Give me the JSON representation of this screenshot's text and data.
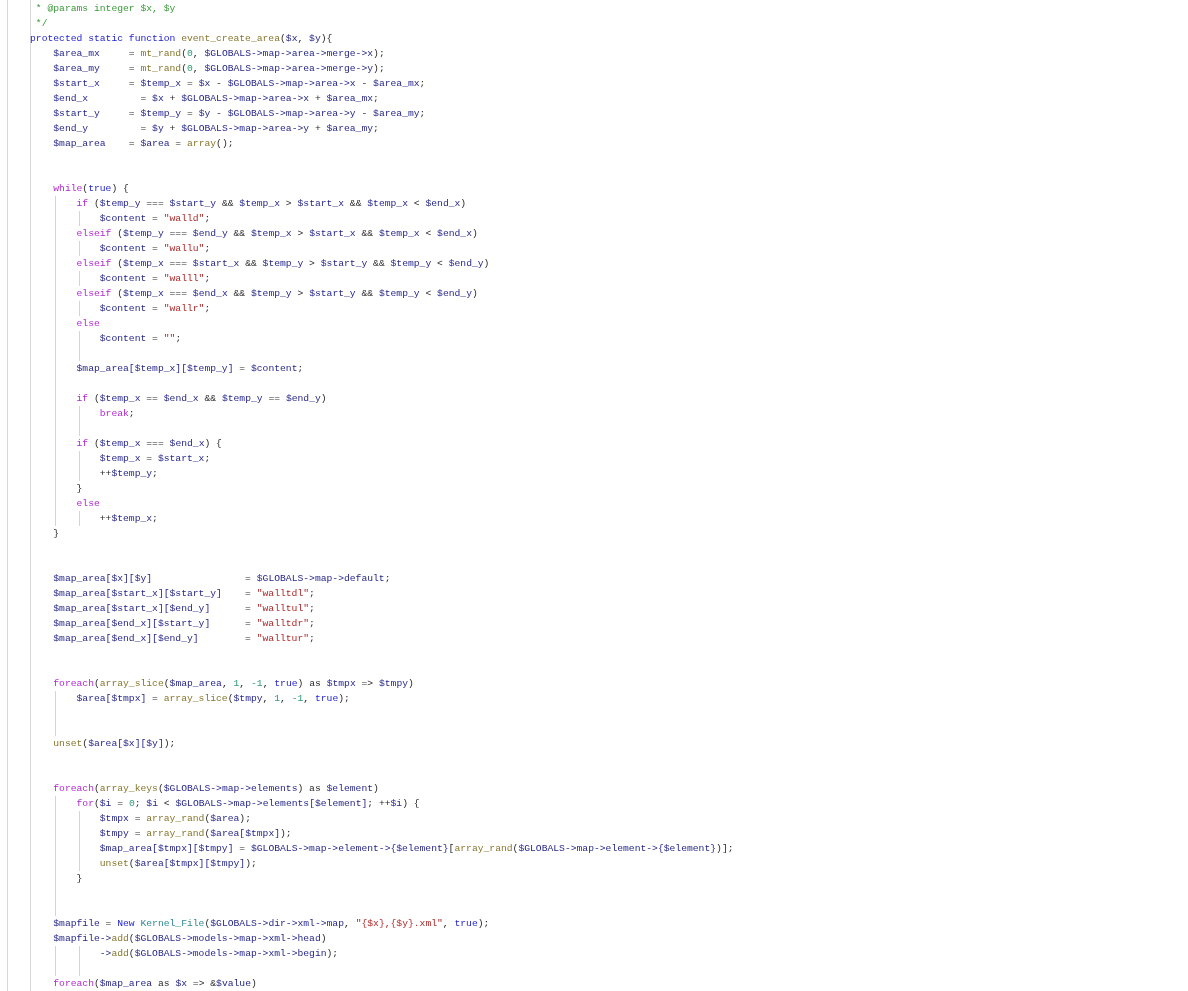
{
  "editor": {
    "lines": [
      {
        "kind": "code",
        "tokens": [
          {
            "kind": "comment",
            "text": " * @params integer $x, $y"
          }
        ]
      },
      {
        "kind": "code",
        "tokens": [
          {
            "kind": "comment",
            "text": " */"
          }
        ]
      },
      {
        "kind": "code",
        "tokens": [
          {
            "kind": "decl",
            "text": "protected static function "
          },
          {
            "kind": "fn",
            "text": "event_create_area"
          },
          {
            "kind": "plain",
            "text": "("
          },
          {
            "kind": "var",
            "text": "$x"
          },
          {
            "kind": "plain",
            "text": ", "
          },
          {
            "kind": "var",
            "text": "$y"
          },
          {
            "kind": "plain",
            "text": "){"
          }
        ]
      },
      {
        "kind": "code",
        "tokens": [
          {
            "kind": "var",
            "text": "    $area_mx"
          },
          {
            "kind": "plain",
            "text": "     = "
          },
          {
            "kind": "fn",
            "text": "mt_rand"
          },
          {
            "kind": "plain",
            "text": "("
          },
          {
            "kind": "num",
            "text": "0"
          },
          {
            "kind": "plain",
            "text": ", "
          },
          {
            "kind": "var",
            "text": "$GLOBALS->map->area->merge->x"
          },
          {
            "kind": "plain",
            "text": ");"
          }
        ]
      },
      {
        "kind": "code",
        "tokens": [
          {
            "kind": "var",
            "text": "    $area_my"
          },
          {
            "kind": "plain",
            "text": "     = "
          },
          {
            "kind": "fn",
            "text": "mt_rand"
          },
          {
            "kind": "plain",
            "text": "("
          },
          {
            "kind": "num",
            "text": "0"
          },
          {
            "kind": "plain",
            "text": ", "
          },
          {
            "kind": "var",
            "text": "$GLOBALS->map->area->merge->y"
          },
          {
            "kind": "plain",
            "text": ");"
          }
        ]
      },
      {
        "kind": "code",
        "tokens": [
          {
            "kind": "var",
            "text": "    $start_x"
          },
          {
            "kind": "plain",
            "text": "     = "
          },
          {
            "kind": "var",
            "text": "$temp_x"
          },
          {
            "kind": "plain",
            "text": " = "
          },
          {
            "kind": "var",
            "text": "$x"
          },
          {
            "kind": "plain",
            "text": " - "
          },
          {
            "kind": "var",
            "text": "$GLOBALS->map->area->x"
          },
          {
            "kind": "plain",
            "text": " - "
          },
          {
            "kind": "var",
            "text": "$area_mx"
          },
          {
            "kind": "plain",
            "text": ";"
          }
        ]
      },
      {
        "kind": "code",
        "tokens": [
          {
            "kind": "var",
            "text": "    $end_x"
          },
          {
            "kind": "plain",
            "text": "         = "
          },
          {
            "kind": "var",
            "text": "$x"
          },
          {
            "kind": "plain",
            "text": " + "
          },
          {
            "kind": "var",
            "text": "$GLOBALS->map->area->x"
          },
          {
            "kind": "plain",
            "text": " + "
          },
          {
            "kind": "var",
            "text": "$area_mx"
          },
          {
            "kind": "plain",
            "text": ";"
          }
        ]
      },
      {
        "kind": "code",
        "tokens": [
          {
            "kind": "var",
            "text": "    $start_y"
          },
          {
            "kind": "plain",
            "text": "     = "
          },
          {
            "kind": "var",
            "text": "$temp_y"
          },
          {
            "kind": "plain",
            "text": " = "
          },
          {
            "kind": "var",
            "text": "$y"
          },
          {
            "kind": "plain",
            "text": " - "
          },
          {
            "kind": "var",
            "text": "$GLOBALS->map->area->y"
          },
          {
            "kind": "plain",
            "text": " - "
          },
          {
            "kind": "var",
            "text": "$area_my"
          },
          {
            "kind": "plain",
            "text": ";"
          }
        ]
      },
      {
        "kind": "code",
        "tokens": [
          {
            "kind": "var",
            "text": "    $end_y"
          },
          {
            "kind": "plain",
            "text": "         = "
          },
          {
            "kind": "var",
            "text": "$y"
          },
          {
            "kind": "plain",
            "text": " + "
          },
          {
            "kind": "var",
            "text": "$GLOBALS->map->area->y"
          },
          {
            "kind": "plain",
            "text": " + "
          },
          {
            "kind": "var",
            "text": "$area_my"
          },
          {
            "kind": "plain",
            "text": ";"
          }
        ]
      },
      {
        "kind": "code",
        "tokens": [
          {
            "kind": "var",
            "text": "    $map_area"
          },
          {
            "kind": "plain",
            "text": "    = "
          },
          {
            "kind": "var",
            "text": "$area"
          },
          {
            "kind": "plain",
            "text": " = "
          },
          {
            "kind": "fn",
            "text": "array"
          },
          {
            "kind": "plain",
            "text": "();"
          }
        ]
      },
      {
        "kind": "blank"
      },
      {
        "kind": "blank"
      },
      {
        "kind": "code",
        "tokens": [
          {
            "kind": "kw",
            "text": "    while"
          },
          {
            "kind": "plain",
            "text": "("
          },
          {
            "kind": "decl",
            "text": "true"
          },
          {
            "kind": "plain",
            "text": ") {"
          }
        ]
      },
      {
        "kind": "code",
        "tokens": [
          {
            "kind": "kw",
            "text": "        if"
          },
          {
            "kind": "plain",
            "text": " ("
          },
          {
            "kind": "var",
            "text": "$temp_y"
          },
          {
            "kind": "plain",
            "text": " === "
          },
          {
            "kind": "var",
            "text": "$start_y"
          },
          {
            "kind": "plain",
            "text": " && "
          },
          {
            "kind": "var",
            "text": "$temp_x"
          },
          {
            "kind": "plain",
            "text": " > "
          },
          {
            "kind": "var",
            "text": "$start_x"
          },
          {
            "kind": "plain",
            "text": " && "
          },
          {
            "kind": "var",
            "text": "$temp_x"
          },
          {
            "kind": "plain",
            "text": " < "
          },
          {
            "kind": "var",
            "text": "$end_x"
          },
          {
            "kind": "plain",
            "text": ")"
          }
        ]
      },
      {
        "kind": "code",
        "tokens": [
          {
            "kind": "var",
            "text": "            $content"
          },
          {
            "kind": "plain",
            "text": " = "
          },
          {
            "kind": "str",
            "text": "\"walld\""
          },
          {
            "kind": "plain",
            "text": ";"
          }
        ]
      },
      {
        "kind": "code",
        "tokens": [
          {
            "kind": "kw",
            "text": "        elseif"
          },
          {
            "kind": "plain",
            "text": " ("
          },
          {
            "kind": "var",
            "text": "$temp_y"
          },
          {
            "kind": "plain",
            "text": " === "
          },
          {
            "kind": "var",
            "text": "$end_y"
          },
          {
            "kind": "plain",
            "text": " && "
          },
          {
            "kind": "var",
            "text": "$temp_x"
          },
          {
            "kind": "plain",
            "text": " > "
          },
          {
            "kind": "var",
            "text": "$start_x"
          },
          {
            "kind": "plain",
            "text": " && "
          },
          {
            "kind": "var",
            "text": "$temp_x"
          },
          {
            "kind": "plain",
            "text": " < "
          },
          {
            "kind": "var",
            "text": "$end_x"
          },
          {
            "kind": "plain",
            "text": ")"
          }
        ]
      },
      {
        "kind": "code",
        "tokens": [
          {
            "kind": "var",
            "text": "            $content"
          },
          {
            "kind": "plain",
            "text": " = "
          },
          {
            "kind": "str",
            "text": "\"wallu\""
          },
          {
            "kind": "plain",
            "text": ";"
          }
        ]
      },
      {
        "kind": "code",
        "tokens": [
          {
            "kind": "kw",
            "text": "        elseif"
          },
          {
            "kind": "plain",
            "text": " ("
          },
          {
            "kind": "var",
            "text": "$temp_x"
          },
          {
            "kind": "plain",
            "text": " === "
          },
          {
            "kind": "var",
            "text": "$start_x"
          },
          {
            "kind": "plain",
            "text": " && "
          },
          {
            "kind": "var",
            "text": "$temp_y"
          },
          {
            "kind": "plain",
            "text": " > "
          },
          {
            "kind": "var",
            "text": "$start_y"
          },
          {
            "kind": "plain",
            "text": " && "
          },
          {
            "kind": "var",
            "text": "$temp_y"
          },
          {
            "kind": "plain",
            "text": " < "
          },
          {
            "kind": "var",
            "text": "$end_y"
          },
          {
            "kind": "plain",
            "text": ")"
          }
        ]
      },
      {
        "kind": "code",
        "tokens": [
          {
            "kind": "var",
            "text": "            $content"
          },
          {
            "kind": "plain",
            "text": " = "
          },
          {
            "kind": "str",
            "text": "\"walll\""
          },
          {
            "kind": "plain",
            "text": ";"
          }
        ]
      },
      {
        "kind": "code",
        "tokens": [
          {
            "kind": "kw",
            "text": "        elseif"
          },
          {
            "kind": "plain",
            "text": " ("
          },
          {
            "kind": "var",
            "text": "$temp_x"
          },
          {
            "kind": "plain",
            "text": " === "
          },
          {
            "kind": "var",
            "text": "$end_x"
          },
          {
            "kind": "plain",
            "text": " && "
          },
          {
            "kind": "var",
            "text": "$temp_y"
          },
          {
            "kind": "plain",
            "text": " > "
          },
          {
            "kind": "var",
            "text": "$start_y"
          },
          {
            "kind": "plain",
            "text": " && "
          },
          {
            "kind": "var",
            "text": "$temp_y"
          },
          {
            "kind": "plain",
            "text": " < "
          },
          {
            "kind": "var",
            "text": "$end_y"
          },
          {
            "kind": "plain",
            "text": ")"
          }
        ]
      },
      {
        "kind": "code",
        "tokens": [
          {
            "kind": "var",
            "text": "            $content"
          },
          {
            "kind": "plain",
            "text": " = "
          },
          {
            "kind": "str",
            "text": "\"wallr\""
          },
          {
            "kind": "plain",
            "text": ";"
          }
        ]
      },
      {
        "kind": "code",
        "tokens": [
          {
            "kind": "kw",
            "text": "        else"
          }
        ]
      },
      {
        "kind": "code",
        "tokens": [
          {
            "kind": "var",
            "text": "            $content"
          },
          {
            "kind": "plain",
            "text": " = "
          },
          {
            "kind": "str",
            "text": "\"\""
          },
          {
            "kind": "plain",
            "text": ";"
          }
        ]
      },
      {
        "kind": "blank"
      },
      {
        "kind": "code",
        "tokens": [
          {
            "kind": "var",
            "text": "        $map_area[$temp_x][$temp_y]"
          },
          {
            "kind": "plain",
            "text": " = "
          },
          {
            "kind": "var",
            "text": "$content"
          },
          {
            "kind": "plain",
            "text": ";"
          }
        ]
      },
      {
        "kind": "blank"
      },
      {
        "kind": "code",
        "tokens": [
          {
            "kind": "kw",
            "text": "        if"
          },
          {
            "kind": "plain",
            "text": " ("
          },
          {
            "kind": "var",
            "text": "$temp_x"
          },
          {
            "kind": "plain",
            "text": " == "
          },
          {
            "kind": "var",
            "text": "$end_x"
          },
          {
            "kind": "plain",
            "text": " && "
          },
          {
            "kind": "var",
            "text": "$temp_y"
          },
          {
            "kind": "plain",
            "text": " == "
          },
          {
            "kind": "var",
            "text": "$end_y"
          },
          {
            "kind": "plain",
            "text": ")"
          }
        ]
      },
      {
        "kind": "code",
        "tokens": [
          {
            "kind": "kw",
            "text": "            break"
          },
          {
            "kind": "plain",
            "text": ";"
          }
        ]
      },
      {
        "kind": "blank"
      },
      {
        "kind": "code",
        "tokens": [
          {
            "kind": "kw",
            "text": "        if"
          },
          {
            "kind": "plain",
            "text": " ("
          },
          {
            "kind": "var",
            "text": "$temp_x"
          },
          {
            "kind": "plain",
            "text": " === "
          },
          {
            "kind": "var",
            "text": "$end_x"
          },
          {
            "kind": "plain",
            "text": ") {"
          }
        ]
      },
      {
        "kind": "code",
        "tokens": [
          {
            "kind": "var",
            "text": "            $temp_x"
          },
          {
            "kind": "plain",
            "text": " = "
          },
          {
            "kind": "var",
            "text": "$start_x"
          },
          {
            "kind": "plain",
            "text": ";"
          }
        ]
      },
      {
        "kind": "code",
        "tokens": [
          {
            "kind": "plain",
            "text": "            ++"
          },
          {
            "kind": "var",
            "text": "$temp_y"
          },
          {
            "kind": "plain",
            "text": ";"
          }
        ]
      },
      {
        "kind": "code",
        "tokens": [
          {
            "kind": "plain",
            "text": "        }"
          }
        ]
      },
      {
        "kind": "code",
        "tokens": [
          {
            "kind": "kw",
            "text": "        else"
          }
        ]
      },
      {
        "kind": "code",
        "tokens": [
          {
            "kind": "plain",
            "text": "            ++"
          },
          {
            "kind": "var",
            "text": "$temp_x"
          },
          {
            "kind": "plain",
            "text": ";"
          }
        ]
      },
      {
        "kind": "code",
        "tokens": [
          {
            "kind": "plain",
            "text": "    }"
          }
        ]
      },
      {
        "kind": "blank"
      },
      {
        "kind": "blank"
      },
      {
        "kind": "code",
        "tokens": [
          {
            "kind": "var",
            "text": "    $map_area[$x][$y]"
          },
          {
            "kind": "plain",
            "text": "                = "
          },
          {
            "kind": "var",
            "text": "$GLOBALS->map->default"
          },
          {
            "kind": "plain",
            "text": ";"
          }
        ]
      },
      {
        "kind": "code",
        "tokens": [
          {
            "kind": "var",
            "text": "    $map_area[$start_x][$start_y]"
          },
          {
            "kind": "plain",
            "text": "    = "
          },
          {
            "kind": "str",
            "text": "\"walltdl\""
          },
          {
            "kind": "plain",
            "text": ";"
          }
        ]
      },
      {
        "kind": "code",
        "tokens": [
          {
            "kind": "var",
            "text": "    $map_area[$start_x][$end_y]"
          },
          {
            "kind": "plain",
            "text": "      = "
          },
          {
            "kind": "str",
            "text": "\"walltul\""
          },
          {
            "kind": "plain",
            "text": ";"
          }
        ]
      },
      {
        "kind": "code",
        "tokens": [
          {
            "kind": "var",
            "text": "    $map_area[$end_x][$start_y]"
          },
          {
            "kind": "plain",
            "text": "      = "
          },
          {
            "kind": "str",
            "text": "\"walltdr\""
          },
          {
            "kind": "plain",
            "text": ";"
          }
        ]
      },
      {
        "kind": "code",
        "tokens": [
          {
            "kind": "var",
            "text": "    $map_area[$end_x][$end_y]"
          },
          {
            "kind": "plain",
            "text": "        = "
          },
          {
            "kind": "str",
            "text": "\"walltur\""
          },
          {
            "kind": "plain",
            "text": ";"
          }
        ]
      },
      {
        "kind": "blank"
      },
      {
        "kind": "blank"
      },
      {
        "kind": "code",
        "tokens": [
          {
            "kind": "kw",
            "text": "    foreach"
          },
          {
            "kind": "plain",
            "text": "("
          },
          {
            "kind": "fn",
            "text": "array_slice"
          },
          {
            "kind": "plain",
            "text": "("
          },
          {
            "kind": "var",
            "text": "$map_area"
          },
          {
            "kind": "plain",
            "text": ", "
          },
          {
            "kind": "num",
            "text": "1"
          },
          {
            "kind": "plain",
            "text": ", "
          },
          {
            "kind": "num",
            "text": "-1"
          },
          {
            "kind": "plain",
            "text": ", "
          },
          {
            "kind": "decl",
            "text": "true"
          },
          {
            "kind": "plain",
            "text": ") as "
          },
          {
            "kind": "var",
            "text": "$tmpx"
          },
          {
            "kind": "plain",
            "text": " => "
          },
          {
            "kind": "var",
            "text": "$tmpy"
          },
          {
            "kind": "plain",
            "text": ")"
          }
        ]
      },
      {
        "kind": "code",
        "tokens": [
          {
            "kind": "var",
            "text": "        $area[$tmpx]"
          },
          {
            "kind": "plain",
            "text": " = "
          },
          {
            "kind": "fn",
            "text": "array_slice"
          },
          {
            "kind": "plain",
            "text": "("
          },
          {
            "kind": "var",
            "text": "$tmpy"
          },
          {
            "kind": "plain",
            "text": ", "
          },
          {
            "kind": "num",
            "text": "1"
          },
          {
            "kind": "plain",
            "text": ", "
          },
          {
            "kind": "num",
            "text": "-1"
          },
          {
            "kind": "plain",
            "text": ", "
          },
          {
            "kind": "decl",
            "text": "true"
          },
          {
            "kind": "plain",
            "text": ");"
          }
        ]
      },
      {
        "kind": "blank"
      },
      {
        "kind": "blank"
      },
      {
        "kind": "code",
        "tokens": [
          {
            "kind": "fn",
            "text": "    unset"
          },
          {
            "kind": "plain",
            "text": "("
          },
          {
            "kind": "var",
            "text": "$area[$x][$y]"
          },
          {
            "kind": "plain",
            "text": ");"
          }
        ]
      },
      {
        "kind": "blank"
      },
      {
        "kind": "blank"
      },
      {
        "kind": "code",
        "tokens": [
          {
            "kind": "kw",
            "text": "    foreach"
          },
          {
            "kind": "plain",
            "text": "("
          },
          {
            "kind": "fn",
            "text": "array_keys"
          },
          {
            "kind": "plain",
            "text": "("
          },
          {
            "kind": "var",
            "text": "$GLOBALS->map->elements"
          },
          {
            "kind": "plain",
            "text": ") as "
          },
          {
            "kind": "var",
            "text": "$element"
          },
          {
            "kind": "plain",
            "text": ")"
          }
        ]
      },
      {
        "kind": "code",
        "tokens": [
          {
            "kind": "kw",
            "text": "        for"
          },
          {
            "kind": "plain",
            "text": "("
          },
          {
            "kind": "var",
            "text": "$i"
          },
          {
            "kind": "plain",
            "text": " = "
          },
          {
            "kind": "num",
            "text": "0"
          },
          {
            "kind": "plain",
            "text": "; "
          },
          {
            "kind": "var",
            "text": "$i"
          },
          {
            "kind": "plain",
            "text": " < "
          },
          {
            "kind": "var",
            "text": "$GLOBALS->map->elements[$element]"
          },
          {
            "kind": "plain",
            "text": "; ++"
          },
          {
            "kind": "var",
            "text": "$i"
          },
          {
            "kind": "plain",
            "text": ") {"
          }
        ]
      },
      {
        "kind": "code",
        "tokens": [
          {
            "kind": "var",
            "text": "            $tmpx"
          },
          {
            "kind": "plain",
            "text": " = "
          },
          {
            "kind": "fn",
            "text": "array_rand"
          },
          {
            "kind": "plain",
            "text": "("
          },
          {
            "kind": "var",
            "text": "$area"
          },
          {
            "kind": "plain",
            "text": ");"
          }
        ]
      },
      {
        "kind": "code",
        "tokens": [
          {
            "kind": "var",
            "text": "            $tmpy"
          },
          {
            "kind": "plain",
            "text": " = "
          },
          {
            "kind": "fn",
            "text": "array_rand"
          },
          {
            "kind": "plain",
            "text": "("
          },
          {
            "kind": "var",
            "text": "$area[$tmpx]"
          },
          {
            "kind": "plain",
            "text": ");"
          }
        ]
      },
      {
        "kind": "code",
        "tokens": [
          {
            "kind": "var",
            "text": "            $map_area[$tmpx][$tmpy]"
          },
          {
            "kind": "plain",
            "text": " = "
          },
          {
            "kind": "var",
            "text": "$GLOBALS->map->element->{$element}"
          },
          {
            "kind": "plain",
            "text": "["
          },
          {
            "kind": "fn",
            "text": "array_rand"
          },
          {
            "kind": "plain",
            "text": "("
          },
          {
            "kind": "var",
            "text": "$GLOBALS->map->element->{$element}"
          },
          {
            "kind": "plain",
            "text": ")];"
          }
        ]
      },
      {
        "kind": "code",
        "tokens": [
          {
            "kind": "fn",
            "text": "            unset"
          },
          {
            "kind": "plain",
            "text": "("
          },
          {
            "kind": "var",
            "text": "$area[$tmpx][$tmpy]"
          },
          {
            "kind": "plain",
            "text": ");"
          }
        ]
      },
      {
        "kind": "code",
        "tokens": [
          {
            "kind": "plain",
            "text": "        }"
          }
        ]
      },
      {
        "kind": "blank"
      },
      {
        "kind": "blank"
      },
      {
        "kind": "code",
        "tokens": [
          {
            "kind": "var",
            "text": "    $mapfile"
          },
          {
            "kind": "plain",
            "text": " = "
          },
          {
            "kind": "decl",
            "text": "New "
          },
          {
            "kind": "cls",
            "text": "Kernel_File"
          },
          {
            "kind": "plain",
            "text": "("
          },
          {
            "kind": "var",
            "text": "$GLOBALS->dir->xml->map"
          },
          {
            "kind": "plain",
            "text": ", "
          },
          {
            "kind": "str",
            "text": "\"{$x},{$y}.xml\""
          },
          {
            "kind": "plain",
            "text": ", "
          },
          {
            "kind": "decl",
            "text": "true"
          },
          {
            "kind": "plain",
            "text": ");"
          }
        ]
      },
      {
        "kind": "code",
        "tokens": [
          {
            "kind": "var",
            "text": "    $mapfile->"
          },
          {
            "kind": "fn",
            "text": "add"
          },
          {
            "kind": "plain",
            "text": "("
          },
          {
            "kind": "var",
            "text": "$GLOBALS->models->map->xml->head"
          },
          {
            "kind": "plain",
            "text": ")"
          }
        ]
      },
      {
        "kind": "code",
        "tokens": [
          {
            "kind": "var",
            "text": "            ->"
          },
          {
            "kind": "fn",
            "text": "add"
          },
          {
            "kind": "plain",
            "text": "("
          },
          {
            "kind": "var",
            "text": "$GLOBALS->models->map->xml->begin"
          },
          {
            "kind": "plain",
            "text": ");"
          }
        ]
      },
      {
        "kind": "blank"
      },
      {
        "kind": "code",
        "tokens": [
          {
            "kind": "kw",
            "text": "    foreach"
          },
          {
            "kind": "plain",
            "text": "("
          },
          {
            "kind": "var",
            "text": "$map_area"
          },
          {
            "kind": "plain",
            "text": " as "
          },
          {
            "kind": "var",
            "text": "$x"
          },
          {
            "kind": "plain",
            "text": " => &"
          },
          {
            "kind": "var",
            "text": "$value"
          },
          {
            "kind": "plain",
            "text": ")"
          }
        ]
      }
    ]
  }
}
